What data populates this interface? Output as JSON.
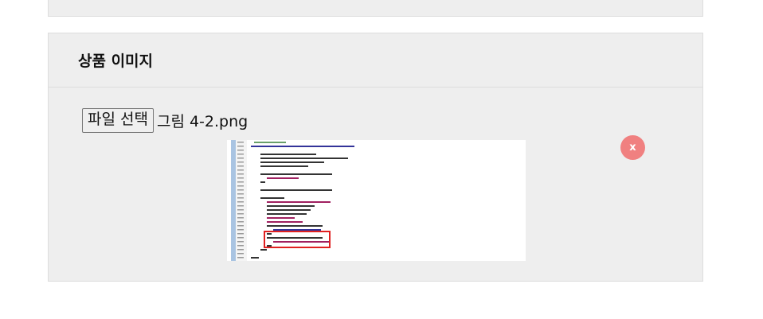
{
  "section": {
    "title": "상품 이미지"
  },
  "file_input": {
    "button_label": "파일 선택",
    "file_name": "그림 4-2.png"
  },
  "preview": {
    "remove_label": "x"
  },
  "colors": {
    "panel_bg": "#eeeeee",
    "panel_border": "#dddddd",
    "remove_button": "#f08080",
    "highlight_box": "#e02020"
  }
}
